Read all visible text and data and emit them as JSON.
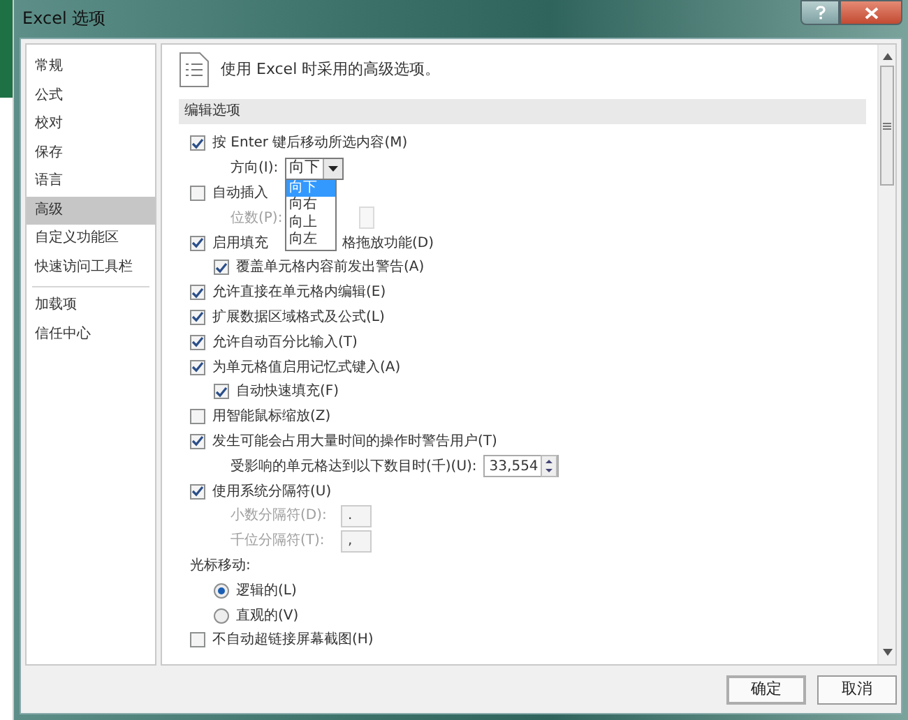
{
  "window": {
    "title": "Excel 选项"
  },
  "title_buttons": [
    {
      "kind": "help"
    },
    {
      "kind": "close"
    }
  ],
  "sidebar": {
    "items": [
      {
        "label": "常规",
        "selected": false
      },
      {
        "label": "公式",
        "selected": false
      },
      {
        "label": "校对",
        "selected": false
      },
      {
        "label": "保存",
        "selected": false
      },
      {
        "label": "语言",
        "selected": false
      },
      {
        "label": "高级",
        "selected": true
      },
      {
        "label": "自定义功能区",
        "selected": false
      },
      {
        "label": "快速访问工具栏",
        "selected": false,
        "divider_after": true
      },
      {
        "label": "加载项",
        "selected": false
      },
      {
        "label": "信任中心",
        "selected": false
      }
    ]
  },
  "header": "使用 Excel 时采用的高级选项。",
  "section": "编辑选项",
  "options": [
    {
      "kind": "checkbox",
      "label": "按 Enter 键后移动所选内容(M)",
      "checked": true,
      "children": [
        {
          "kind": "dropdown",
          "label": "方向(I):",
          "value": "向下",
          "menu": [
            {
              "label": "向下",
              "selected": true
            },
            {
              "label": "向右",
              "selected": false
            },
            {
              "label": "向上",
              "selected": false
            },
            {
              "label": "向左",
              "selected": false
            }
          ]
        }
      ]
    },
    {
      "kind": "checkbox",
      "label": "自动插入",
      "checked": false,
      "children": [
        {
          "kind": "spin",
          "label": "位数(P):",
          "disabled": true
        }
      ]
    },
    {
      "kind": "checkbox",
      "label": "启用填充",
      "label_after": "格拖放功能(D)",
      "checked": true,
      "children": [
        {
          "kind": "checkbox",
          "label": "覆盖单元格内容前发出警告(A)",
          "checked": true
        }
      ]
    },
    {
      "kind": "checkbox",
      "label": "允许直接在单元格内编辑(E)",
      "checked": true
    },
    {
      "kind": "checkbox",
      "label": "扩展数据区域格式及公式(L)",
      "checked": true
    },
    {
      "kind": "checkbox",
      "label": "允许自动百分比输入(T)",
      "checked": true
    },
    {
      "kind": "checkbox",
      "label": "为单元格值启用记忆式键入(A)",
      "checked": true,
      "children": [
        {
          "kind": "checkbox",
          "label": "自动快速填充(F)",
          "checked": true
        }
      ]
    },
    {
      "kind": "checkbox",
      "label": "用智能鼠标缩放(Z)",
      "checked": false
    },
    {
      "kind": "checkbox",
      "label": "发生可能会占用大量时间的操作时警告用户(T)",
      "checked": true,
      "children": [
        {
          "kind": "number",
          "label": "受影响的单元格达到以下数目时(千)(U):",
          "value": "33,554"
        }
      ]
    },
    {
      "kind": "checkbox",
      "label": "使用系统分隔符(U)",
      "checked": true,
      "children": [
        {
          "kind": "field",
          "label": "小数分隔符(D):",
          "value": ".",
          "disabled": true
        },
        {
          "kind": "field",
          "label": "千位分隔符(T):",
          "value": ",",
          "disabled": true
        }
      ]
    },
    {
      "kind": "label",
      "label": "光标移动:",
      "children": [
        {
          "kind": "radio",
          "label": "逻辑的(L)",
          "selected": true
        },
        {
          "kind": "radio",
          "label": "直观的(V)",
          "selected": false
        }
      ]
    },
    {
      "kind": "checkbox",
      "label": "不自动超链接屏幕截图(H)",
      "checked": false
    }
  ],
  "buttons": [
    "确定",
    "取消"
  ]
}
